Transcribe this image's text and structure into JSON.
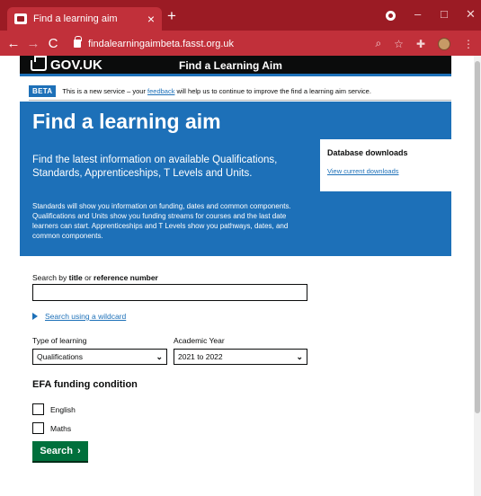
{
  "browser": {
    "tab_title": "Find a learning aim",
    "tab_close": "×",
    "new_tab": "+",
    "url": "findalearningaimbeta.fasst.org.uk",
    "controls": {
      "minimize": "–",
      "maximize": "□",
      "close": "✕"
    },
    "nav": {
      "back": "←",
      "forward": "→",
      "reload": "C"
    },
    "toolbar_icons": {
      "zoom": "⌕",
      "bookmark": "☆",
      "extensions": "✚",
      "menu": "⋮"
    }
  },
  "header": {
    "logo_text": "GOV.UK",
    "service_name": "Find a Learning Aim"
  },
  "phase_banner": {
    "tag": "BETA",
    "text_before": "This is a new service – your ",
    "link": "feedback",
    "text_after": " will help us to continue to improve the find a learning aim service."
  },
  "hero": {
    "title": "Find a learning aim",
    "lead": "Find the latest information on available Qualifications, Standards, Apprenticeships, T Levels and Units.",
    "body": "Standards will show you information on funding, dates and common components. Qualifications and Units show you funding streams for courses and the last date learners can start. Apprenticeships and T Levels show you pathways, dates, and common components.",
    "downloads": {
      "heading": "Database downloads",
      "link": "View current downloads"
    }
  },
  "search": {
    "label_prefix": "Search by ",
    "label_bold1": "title",
    "label_or": " or ",
    "label_bold2": "reference number",
    "input_value": "",
    "wildcard_link": "Search using a wildcard",
    "type_label": "Type of learning",
    "type_value": "Qualifications",
    "year_label": "Academic Year",
    "year_value": "2021 to 2022",
    "efa_heading": "EFA funding condition",
    "checkboxes": [
      {
        "label": "English",
        "checked": false
      },
      {
        "label": "Maths",
        "checked": false
      }
    ],
    "button_label": "Search",
    "button_arrow": "›"
  }
}
